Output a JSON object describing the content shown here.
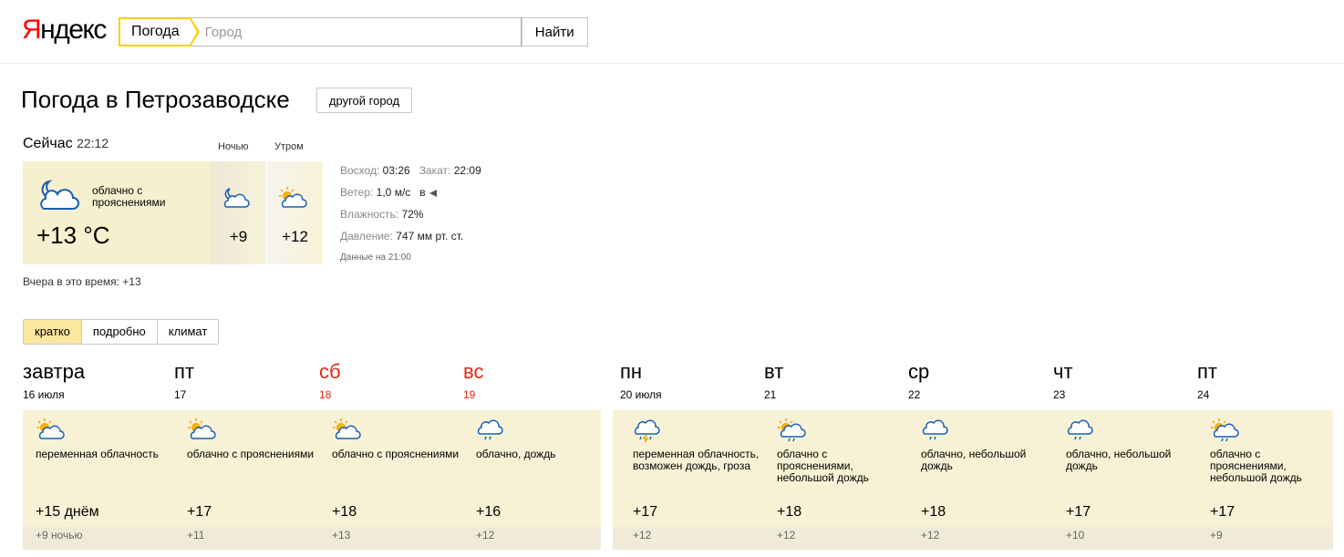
{
  "header": {
    "logo_first": "Я",
    "logo_rest": "ндекс",
    "search_tab": "Погода",
    "search_placeholder": "Город",
    "search_button": "Найти"
  },
  "page": {
    "title": "Погода в Петрозаводске",
    "other_city": "другой город"
  },
  "now": {
    "label": "Сейчас",
    "time": "22:12",
    "desc": "облачно с прояснениями",
    "temp": "+13 °C",
    "icon": "moon-cloud-icon",
    "night_label": "Ночью",
    "night_temp": "+9",
    "night_icon": "moon-cloud-icon",
    "morning_label": "Утром",
    "morning_temp": "+12",
    "morning_icon": "sun-cloud-icon",
    "sunrise_label": "Восход:",
    "sunrise": "03:26",
    "sunset_label": "Закат:",
    "sunset": "22:09",
    "wind_label": "Ветер:",
    "wind": "1,0 м/с",
    "wind_dir": "в",
    "humidity_label": "Влажность:",
    "humidity": "72%",
    "pressure_label": "Давление:",
    "pressure": "747 мм рт. ст.",
    "data_note": "Данные на 21:00",
    "yesterday": "Вчера в это время: +13"
  },
  "tabs": [
    "кратко",
    "подробно",
    "климат"
  ],
  "forecast": [
    {
      "name": "завтра",
      "date": "16 июля",
      "weekend": false,
      "icon": "sun-cloud-icon",
      "desc": "переменная облачность",
      "day": "+15 днём",
      "night": "+9 ночью"
    },
    {
      "name": "пт",
      "date": "17",
      "weekend": false,
      "icon": "sun-cloud-icon",
      "desc": "облачно с прояснениями",
      "day": "+17",
      "night": "+11"
    },
    {
      "name": "сб",
      "date": "18",
      "weekend": true,
      "icon": "sun-cloud-icon",
      "desc": "облачно с прояснениями",
      "day": "+18",
      "night": "+13"
    },
    {
      "name": "вс",
      "date": "19",
      "weekend": true,
      "icon": "rain-cloud-icon",
      "desc": "облачно, дождь",
      "day": "+16",
      "night": "+12"
    },
    {
      "name": "пн",
      "date": "20 июля",
      "weekend": false,
      "icon": "thunder-cloud-icon",
      "desc": "переменная облачность, возможен дождь, гроза",
      "day": "+17",
      "night": "+12"
    },
    {
      "name": "вт",
      "date": "21",
      "weekend": false,
      "icon": "sun-rain-cloud-icon",
      "desc": "облачно с прояснениями, небольшой дождь",
      "day": "+18",
      "night": "+12"
    },
    {
      "name": "ср",
      "date": "22",
      "weekend": false,
      "icon": "rain-cloud-icon",
      "desc": "облачно, небольшой дождь",
      "day": "+18",
      "night": "+12"
    },
    {
      "name": "чт",
      "date": "23",
      "weekend": false,
      "icon": "rain-cloud-icon",
      "desc": "облачно, небольшой дождь",
      "day": "+17",
      "night": "+10"
    },
    {
      "name": "пт",
      "date": "24",
      "weekend": false,
      "icon": "sun-rain-cloud-icon",
      "desc": "облачно с прояснениями, небольшой дождь",
      "day": "+17",
      "night": "+9"
    }
  ],
  "colors": {
    "accent": "#ffcc00",
    "weekend": "#e8280e",
    "card_bg": "#f7f2d5"
  }
}
